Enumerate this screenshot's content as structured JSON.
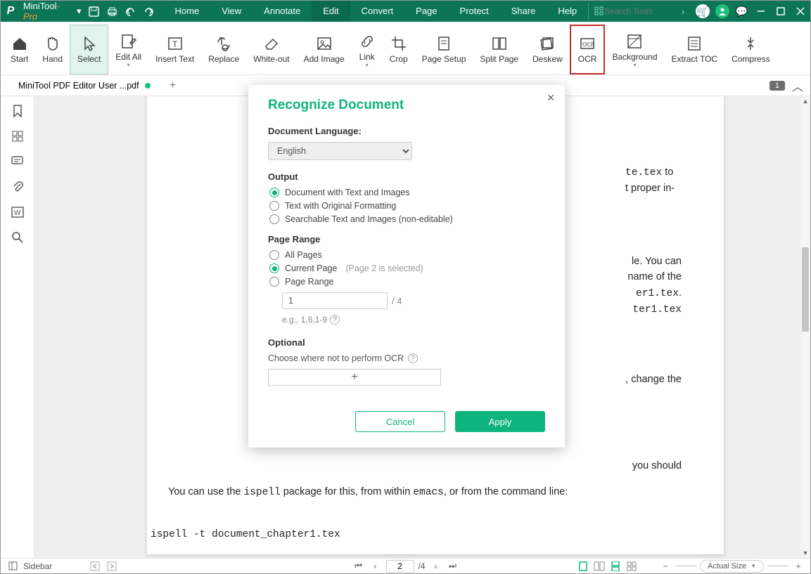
{
  "app": {
    "name": "MiniTool",
    "suffix": "-Pro",
    "search_placeholder": "Search Tools"
  },
  "menu": [
    "Home",
    "View",
    "Annotate",
    "Edit",
    "Convert",
    "Page",
    "Protect",
    "Share",
    "Help"
  ],
  "active_menu": "Edit",
  "ribbon": [
    {
      "label": "Start",
      "icon": "home"
    },
    {
      "label": "Hand",
      "icon": "hand"
    },
    {
      "label": "Select",
      "icon": "cursor",
      "selected": true
    },
    {
      "label": "Edit All",
      "icon": "edit-all",
      "drop": true
    },
    {
      "label": "Insert Text",
      "icon": "insert-text"
    },
    {
      "label": "Replace",
      "icon": "replace"
    },
    {
      "label": "White-out",
      "icon": "eraser"
    },
    {
      "label": "Add Image",
      "icon": "image"
    },
    {
      "label": "Link",
      "icon": "link",
      "drop": true
    },
    {
      "label": "Crop",
      "icon": "crop"
    },
    {
      "label": "Page Setup",
      "icon": "page-setup"
    },
    {
      "label": "Split Page",
      "icon": "split"
    },
    {
      "label": "Deskew",
      "icon": "deskew"
    },
    {
      "label": "OCR",
      "icon": "ocr",
      "highlighted": true
    },
    {
      "label": "Background",
      "icon": "background",
      "drop": true
    },
    {
      "label": "Extract TOC",
      "icon": "toc"
    },
    {
      "label": "Compress",
      "icon": "compress"
    }
  ],
  "tab": {
    "name": "MiniTool PDF Editor User ...pdf",
    "modified": true
  },
  "page_indicator": "1",
  "dialog": {
    "title": "Recognize Document",
    "doc_lang_label": "Document Language:",
    "doc_lang_value": "English",
    "output_label": "Output",
    "output_options": [
      "Document with Text and Images",
      "Text with Original Formatting",
      "Searchable Text and Images (non-editable)"
    ],
    "output_selected": 0,
    "range_label": "Page Range",
    "range_all": "All Pages",
    "range_current": "Current Page",
    "range_current_hint": "(Page 2 is selected)",
    "range_custom": "Page Range",
    "range_input": "1",
    "range_total": " / 4",
    "range_example": "e.g., 1,6,1-9",
    "optional_label": "Optional",
    "optional_hint": "Choose where not to perform OCR",
    "cancel": "Cancel",
    "apply": "Apply"
  },
  "doc": {
    "frag1_a": "te.tex",
    "frag1_b": " to",
    "frag2": "t proper in-",
    "frag3": "le. You can",
    "frag4": "name of the",
    "frag5a": "er1.tex",
    "frag5b": ".",
    "frag6": "ter1.tex",
    "frag7": ", change the",
    "frag8": "you should ",
    "line1a": "You can use the ",
    "line1b": "ispell",
    "line1c": " package for this, from within ",
    "line1d": "emacs",
    "line1e": ", or from the command line:",
    "cmd": "ispell -t document_chapter1.tex"
  },
  "status": {
    "sidebar": "Sidebar",
    "page": "2",
    "total": "/4",
    "zoom": "Actual Size"
  }
}
